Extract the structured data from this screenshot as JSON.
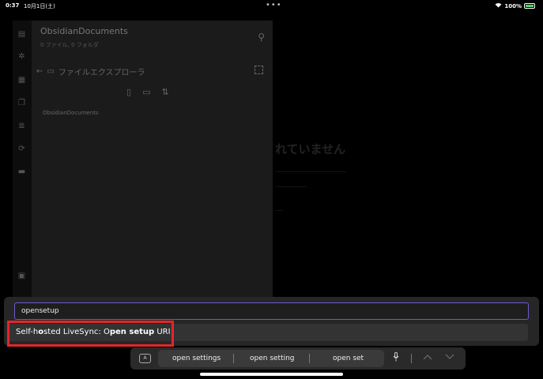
{
  "status": {
    "time": "0:37",
    "date": "10月1日(土)",
    "dots": "•••",
    "battery_pct": "100%"
  },
  "sidebar": {
    "vault_title": "ObsidianDocuments",
    "vault_sub": "0 ファイル, 0 フォルダ",
    "explorer_label": "ファイルエクスプローラ",
    "folder_item": "ObsidianDocuments"
  },
  "main": {
    "bg_text": "れていません"
  },
  "palette": {
    "input_value": "opensetup",
    "suggestion_prefix": "Self-h",
    "suggestion_o": "o",
    "suggestion_mid": "sted LiveSync: O",
    "suggestion_bold": "pen setup",
    "suggestion_suffix": " URI"
  },
  "keyboard": {
    "key_label": "A",
    "predictions": [
      "open settings",
      "open setting",
      "open set"
    ]
  },
  "icons": {
    "mic": "microphone-icon",
    "up": "chevron-up-icon",
    "down": "chevron-down-icon",
    "pin": "pin-icon",
    "back": "arrow-left-icon",
    "folder": "folder-icon",
    "new_file": "new-file-icon",
    "new_folder": "new-folder-icon",
    "sort": "sort-icon"
  },
  "colors": {
    "accent_border": "#6a5acd",
    "highlight_red": "#e3262b"
  }
}
